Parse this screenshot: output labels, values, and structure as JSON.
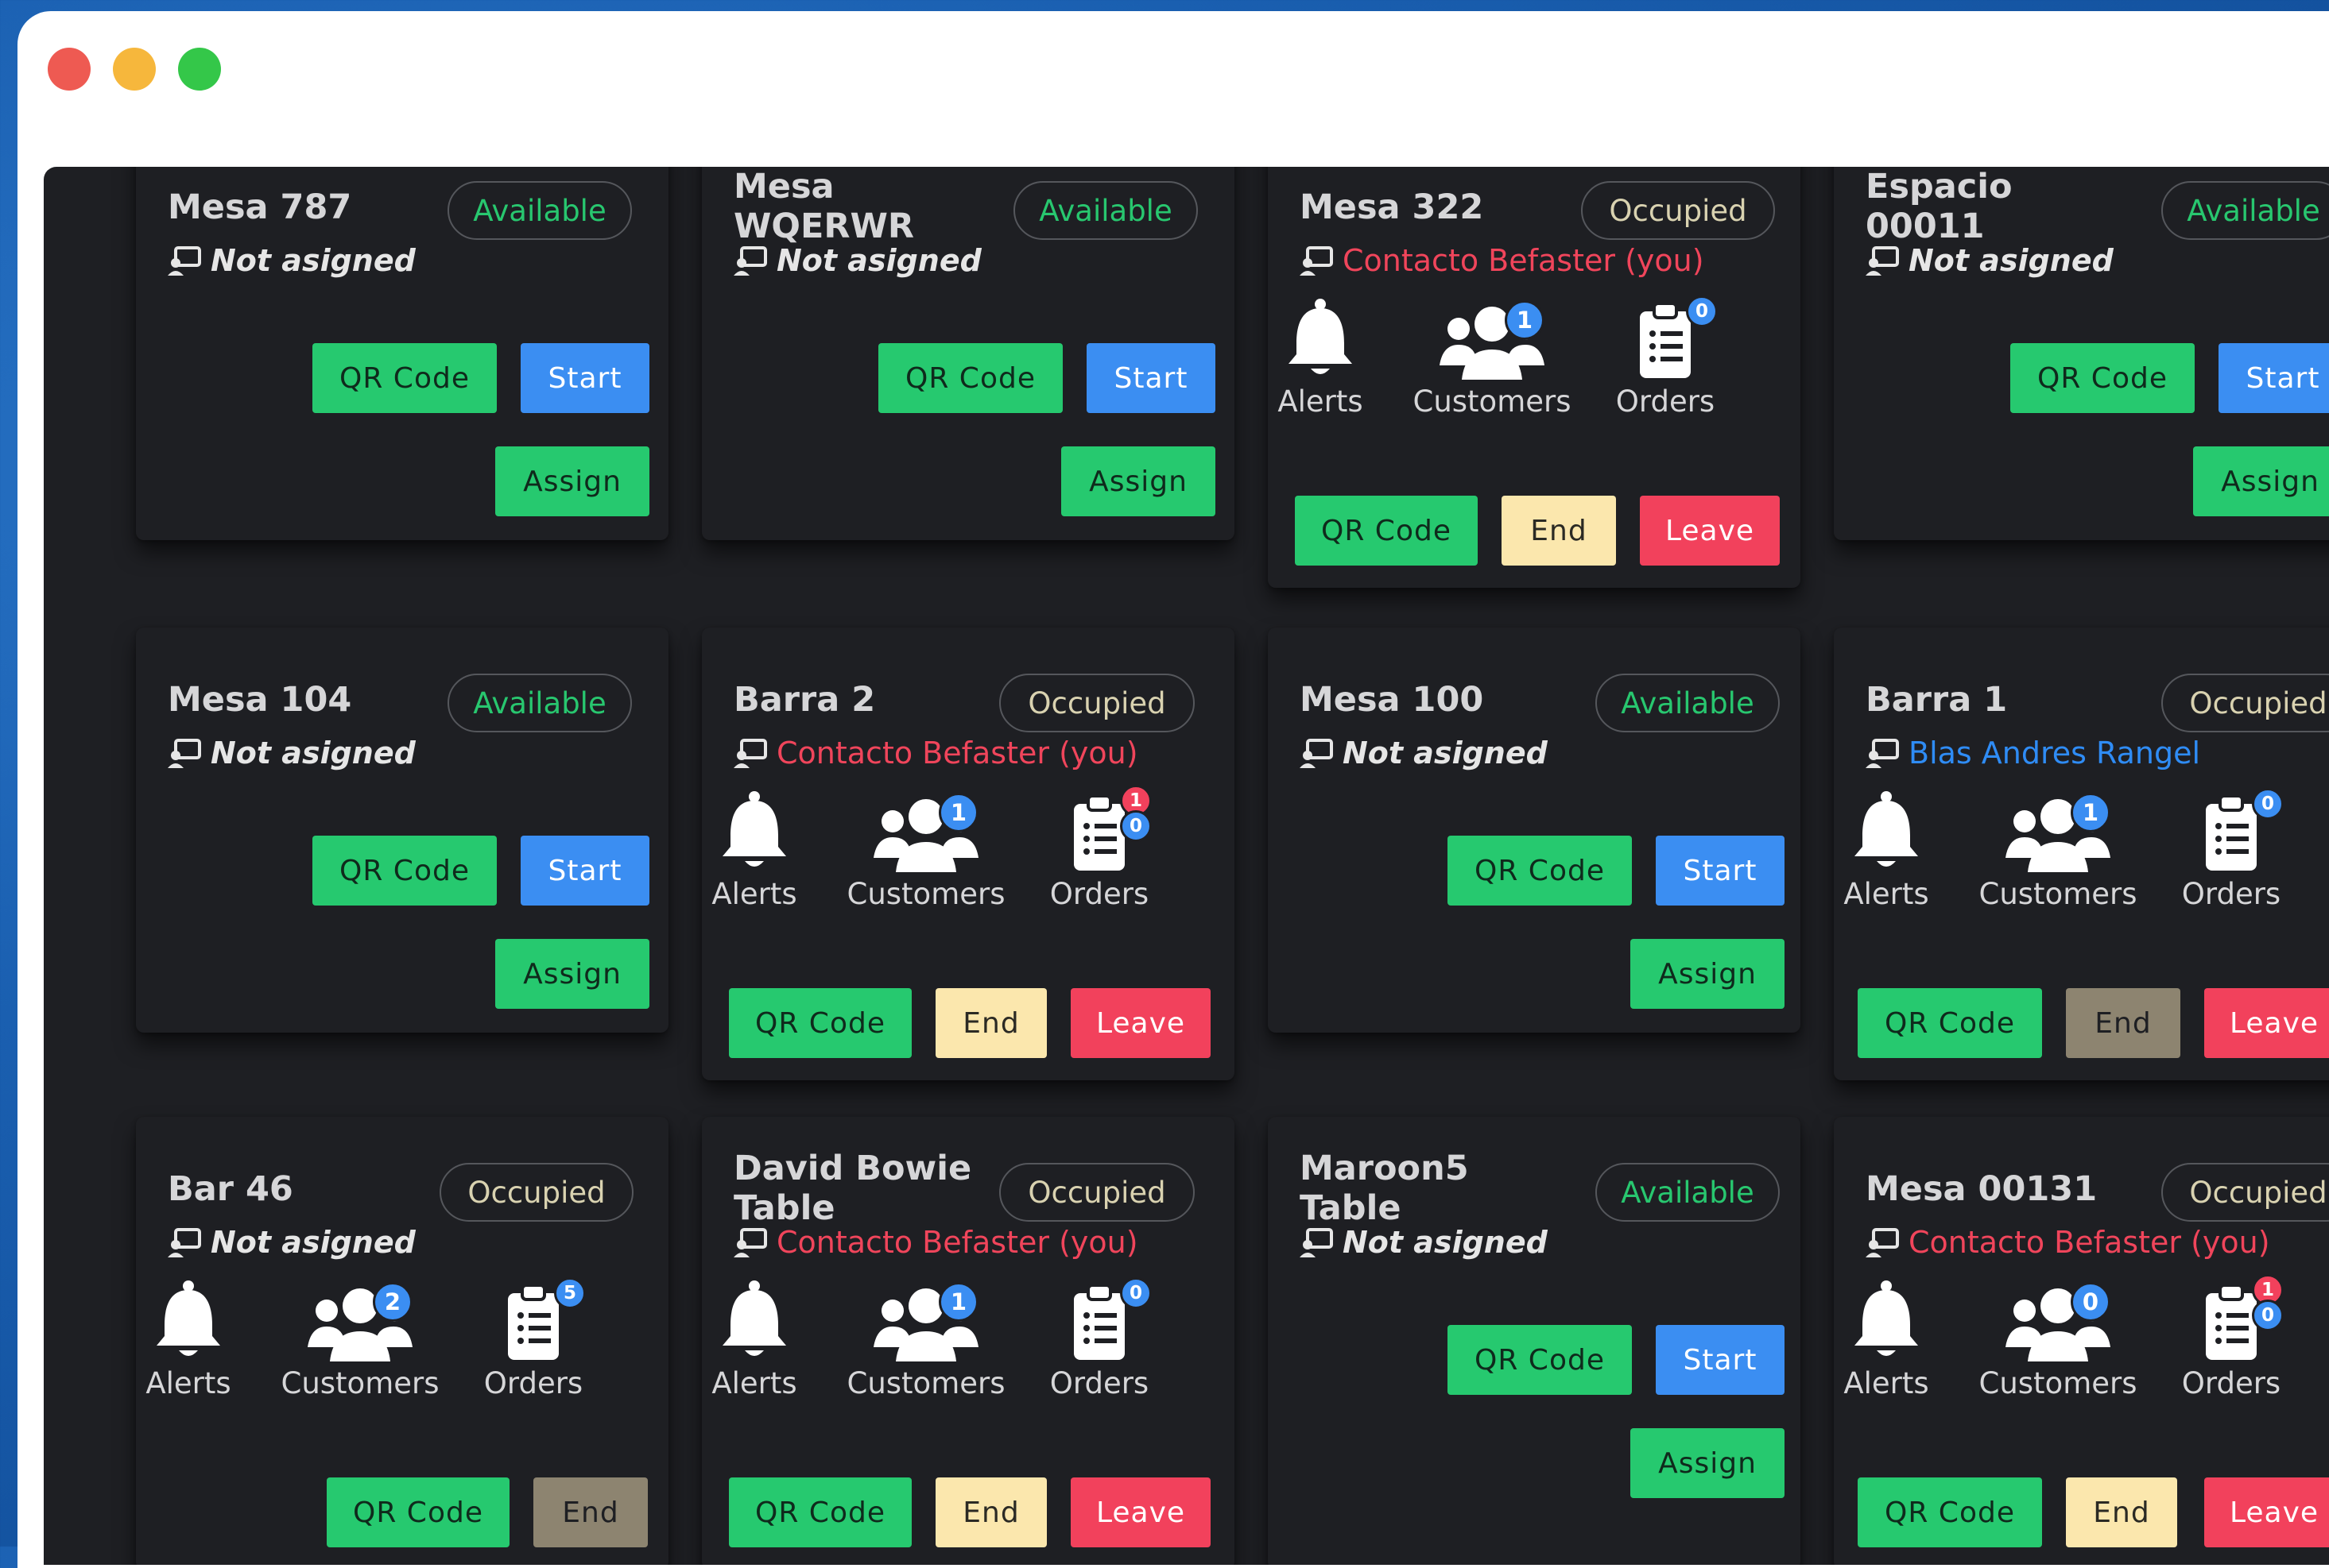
{
  "window": {
    "controls": [
      {
        "name": "close",
        "color": "#ee5a52"
      },
      {
        "name": "minimize",
        "color": "#f6b73c"
      },
      {
        "name": "maximize",
        "color": "#34c749"
      }
    ]
  },
  "labels": {
    "alerts": "Alerts",
    "customers": "Customers",
    "orders": "Orders",
    "qr": "QR Code",
    "start": "Start",
    "assign": "Assign",
    "end": "End",
    "leave": "Leave"
  },
  "tables": [
    {
      "title": "Mesa 787",
      "status": "Available",
      "assignee": "Not asigned"
    },
    {
      "title": "Mesa\nWQERWR",
      "status": "Available",
      "assignee": "Not asigned"
    },
    {
      "title": "Mesa 322",
      "status": "Occupied",
      "assignee": "Contacto Befaster (you)",
      "customers": "1",
      "orders_top": "",
      "orders_bottom": "0"
    },
    {
      "title": "Espacio\n00011",
      "status": "Available",
      "assignee": "Not asigned"
    },
    {
      "title": "Mesa 104",
      "status": "Available",
      "assignee": "Not asigned"
    },
    {
      "title": "Barra 2",
      "status": "Occupied",
      "assignee": "Contacto Befaster (you)",
      "customers": "1",
      "orders_top": "1",
      "orders_bottom": "0"
    },
    {
      "title": "Mesa 100",
      "status": "Available",
      "assignee": "Not asigned"
    },
    {
      "title": "Barra 1",
      "status": "Occupied",
      "assignee": "Blas Andres Rangel",
      "customers": "1",
      "orders_top": "",
      "orders_bottom": "0"
    },
    {
      "title": "Bar 46",
      "status": "Occupied",
      "assignee": "Not asigned",
      "customers": "2",
      "orders_top": "",
      "orders_bottom": "5"
    },
    {
      "title": "David Bowie\nTable",
      "status": "Occupied",
      "assignee": "Contacto Befaster (you)",
      "customers": "1",
      "orders_top": "",
      "orders_bottom": "0"
    },
    {
      "title": "Maroon5\nTable",
      "status": "Available",
      "assignee": "Not asigned"
    },
    {
      "title": "Mesa 00131",
      "status": "Occupied",
      "assignee": "Contacto Befaster (you)",
      "customers": "0",
      "orders_top": "1",
      "orders_bottom": "0"
    }
  ]
}
